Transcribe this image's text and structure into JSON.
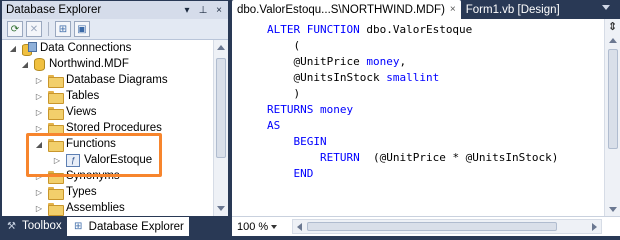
{
  "left_panel": {
    "title": "Database Explorer",
    "title_controls": {
      "dropdown": "▾",
      "pin": "⊥",
      "close": "×"
    },
    "tree": [
      {
        "label": "Data Connections",
        "icon": "data-connections-icon",
        "expander": "◢",
        "level": 0
      },
      {
        "label": "Northwind.MDF",
        "icon": "database-icon",
        "expander": "◢",
        "level": 1
      },
      {
        "label": "Database Diagrams",
        "icon": "folder-icon",
        "expander": "▷",
        "level": 2
      },
      {
        "label": "Tables",
        "icon": "folder-icon",
        "expander": "▷",
        "level": 2
      },
      {
        "label": "Views",
        "icon": "folder-icon",
        "expander": "▷",
        "level": 2
      },
      {
        "label": "Stored Procedures",
        "icon": "folder-icon",
        "expander": "▷",
        "level": 2
      },
      {
        "label": "Functions",
        "icon": "folder-icon",
        "expander": "◢",
        "level": 2
      },
      {
        "label": "ValorEstoque",
        "icon": "function-icon",
        "expander": "▷",
        "level": 3
      },
      {
        "label": "Synonyms",
        "icon": "folder-icon",
        "expander": "▷",
        "level": 2
      },
      {
        "label": "Types",
        "icon": "folder-icon",
        "expander": "▷",
        "level": 2
      },
      {
        "label": "Assemblies",
        "icon": "folder-icon",
        "expander": "▷",
        "level": 2
      }
    ],
    "bottom_tabs": [
      {
        "label": "Toolbox",
        "icon": "toolbox-icon",
        "active": false
      },
      {
        "label": "Database Explorer",
        "icon": "database-explorer-icon",
        "active": true
      }
    ],
    "highlight_color": "#f7852d"
  },
  "document_tabs": [
    {
      "label": "dbo.ValorEstoqu...S\\NORTHWIND.MDF)",
      "active": true,
      "close": "×"
    },
    {
      "label": "Form1.vb [Design]",
      "active": false
    }
  ],
  "editor": {
    "lines": [
      [
        {
          "t": "ALTER FUNCTION ",
          "c": "kw"
        },
        {
          "t": "dbo.ValorEstoque",
          "c": "id"
        }
      ],
      [
        {
          "t": "    (",
          "c": "id"
        }
      ],
      [
        {
          "t": "    @UnitPrice ",
          "c": "id"
        },
        {
          "t": "money",
          "c": "kw"
        },
        {
          "t": ",",
          "c": "id"
        }
      ],
      [
        {
          "t": "    @UnitsInStock ",
          "c": "id"
        },
        {
          "t": "smallint",
          "c": "kw"
        }
      ],
      [
        {
          "t": "    )",
          "c": "id"
        }
      ],
      [
        {
          "t": "RETURNS money",
          "c": "kw"
        }
      ],
      [
        {
          "t": "AS",
          "c": "kw"
        }
      ],
      [
        {
          "t": "    BEGIN",
          "c": "kw"
        }
      ],
      [
        {
          "t": "        RETURN  ",
          "c": "kw"
        },
        {
          "t": "(@UnitPrice * @UnitsInStock)",
          "c": "id"
        }
      ],
      [
        {
          "t": "    END",
          "c": "kw"
        }
      ]
    ],
    "zoom": "100 %",
    "keyword_color": "#0000ff"
  }
}
